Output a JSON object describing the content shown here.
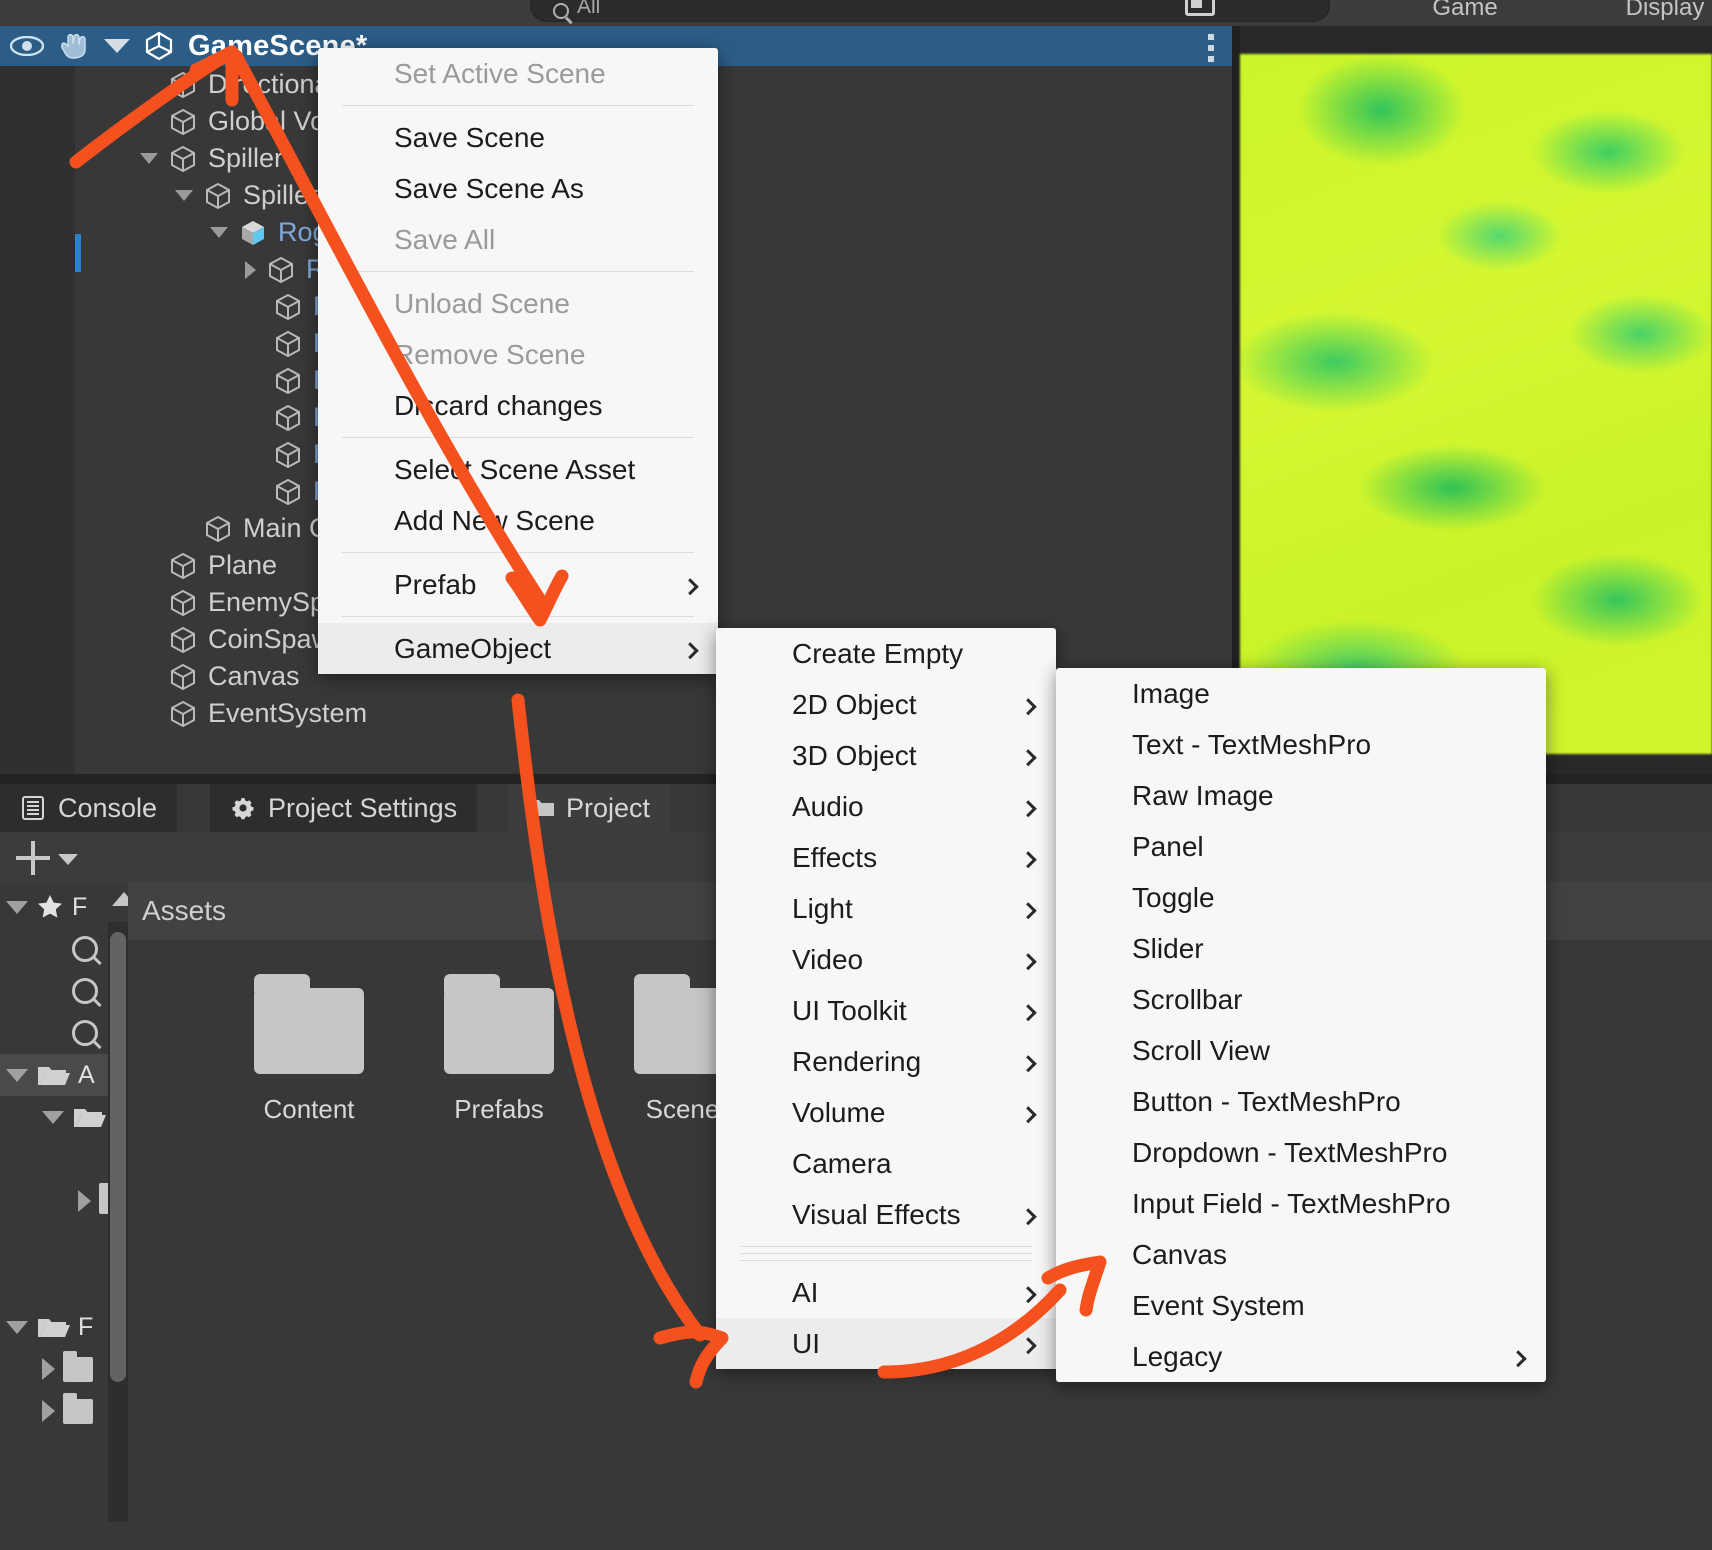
{
  "topbar": {
    "search_placeholder": "All",
    "search_icon": "search-icon",
    "game_tab": "Game",
    "display_tab": "Display"
  },
  "hierarchy": {
    "scene_name": "GameScene*",
    "visibility_icon": "eye-icon",
    "pickability_icon": "hand-icon",
    "unity_icon": "unity-cube-icon",
    "overflow_icon": "kebab-menu-icon",
    "items": [
      {
        "label": "Directiona",
        "indent": 1,
        "fold": "none",
        "icon": "gameobject-cube-icon",
        "blue": false
      },
      {
        "label": "Global Vol",
        "indent": 1,
        "fold": "none",
        "icon": "gameobject-cube-icon",
        "blue": false
      },
      {
        "label": "Spiller",
        "indent": 1,
        "fold": "open",
        "icon": "gameobject-cube-icon",
        "blue": false
      },
      {
        "label": "SpillerM",
        "indent": 2,
        "fold": "open",
        "icon": "gameobject-cube-icon",
        "blue": false
      },
      {
        "label": "Rogue",
        "indent": 3,
        "fold": "open",
        "icon": "prefab-icon",
        "blue": true
      },
      {
        "label": "Rig",
        "indent": 4,
        "fold": "closed",
        "icon": "gameobject-cube-icon",
        "blue": true
      },
      {
        "label": "Rog",
        "indent": 4,
        "fold": "none",
        "icon": "gameobject-cube-icon",
        "blue": true
      },
      {
        "label": "Rog",
        "indent": 4,
        "fold": "none",
        "icon": "gameobject-cube-icon",
        "blue": true
      },
      {
        "label": "Rog",
        "indent": 4,
        "fold": "none",
        "icon": "gameobject-cube-icon",
        "blue": true
      },
      {
        "label": "Rog",
        "indent": 4,
        "fold": "none",
        "icon": "gameobject-cube-icon",
        "blue": true
      },
      {
        "label": "Rog",
        "indent": 4,
        "fold": "none",
        "icon": "gameobject-cube-icon",
        "blue": true
      },
      {
        "label": "Rog",
        "indent": 4,
        "fold": "none",
        "icon": "gameobject-cube-icon",
        "blue": true
      },
      {
        "label": "Main Ca",
        "indent": 2,
        "fold": "none",
        "icon": "gameobject-cube-icon",
        "blue": false
      },
      {
        "label": "Plane",
        "indent": 1,
        "fold": "none",
        "icon": "gameobject-cube-icon",
        "blue": false
      },
      {
        "label": "EnemySpa",
        "indent": 1,
        "fold": "none",
        "icon": "gameobject-cube-icon",
        "blue": false
      },
      {
        "label": "CoinSpawn",
        "indent": 1,
        "fold": "none",
        "icon": "gameobject-cube-icon",
        "blue": false
      },
      {
        "label": "Canvas",
        "indent": 1,
        "fold": "none",
        "icon": "gameobject-cube-icon",
        "blue": false
      },
      {
        "label": "EventSystem",
        "indent": 1,
        "fold": "none",
        "icon": "gameobject-cube-icon",
        "blue": false
      }
    ]
  },
  "scene_menu": {
    "items": [
      {
        "label": "Set Active Scene",
        "state": "disabled",
        "submenu": false,
        "sep_after": true
      },
      {
        "label": "Save Scene",
        "state": "normal",
        "submenu": false,
        "sep_after": false
      },
      {
        "label": "Save Scene As",
        "state": "normal",
        "submenu": false,
        "sep_after": false
      },
      {
        "label": "Save All",
        "state": "disabled",
        "submenu": false,
        "sep_after": true
      },
      {
        "label": "Unload Scene",
        "state": "disabled",
        "submenu": false,
        "sep_after": false
      },
      {
        "label": "Remove Scene",
        "state": "disabled",
        "submenu": false,
        "sep_after": false
      },
      {
        "label": "Discard changes",
        "state": "normal",
        "submenu": false,
        "sep_after": true
      },
      {
        "label": "Select Scene Asset",
        "state": "normal",
        "submenu": false,
        "sep_after": false
      },
      {
        "label": "Add New Scene",
        "state": "normal",
        "submenu": false,
        "sep_after": true
      },
      {
        "label": "Prefab",
        "state": "normal",
        "submenu": true,
        "sep_after": true
      },
      {
        "label": "GameObject",
        "state": "highlight",
        "submenu": true,
        "sep_after": false
      }
    ]
  },
  "gameobject_menu": {
    "items": [
      {
        "label": "Create Empty",
        "state": "normal",
        "submenu": false,
        "sep_after": false
      },
      {
        "label": "2D Object",
        "state": "normal",
        "submenu": true,
        "sep_after": false
      },
      {
        "label": "3D Object",
        "state": "normal",
        "submenu": true,
        "sep_after": false
      },
      {
        "label": "Audio",
        "state": "normal",
        "submenu": true,
        "sep_after": false
      },
      {
        "label": "Effects",
        "state": "normal",
        "submenu": true,
        "sep_after": false
      },
      {
        "label": "Light",
        "state": "normal",
        "submenu": true,
        "sep_after": false
      },
      {
        "label": "Video",
        "state": "normal",
        "submenu": true,
        "sep_after": false
      },
      {
        "label": "UI Toolkit",
        "state": "normal",
        "submenu": true,
        "sep_after": false
      },
      {
        "label": "Rendering",
        "state": "normal",
        "submenu": true,
        "sep_after": false
      },
      {
        "label": "Volume",
        "state": "normal",
        "submenu": true,
        "sep_after": false
      },
      {
        "label": "Camera",
        "state": "normal",
        "submenu": false,
        "sep_after": false
      },
      {
        "label": "Visual Effects",
        "state": "normal",
        "submenu": true,
        "sep_after": true
      },
      {
        "label": "AI",
        "state": "normal",
        "submenu": true,
        "sep_after": false
      },
      {
        "label": "UI",
        "state": "highlight",
        "submenu": true,
        "sep_after": false
      }
    ]
  },
  "ui_menu": {
    "items": [
      {
        "label": "Image",
        "state": "normal",
        "submenu": false
      },
      {
        "label": "Text - TextMeshPro",
        "state": "normal",
        "submenu": false
      },
      {
        "label": "Raw Image",
        "state": "normal",
        "submenu": false
      },
      {
        "label": "Panel",
        "state": "normal",
        "submenu": false
      },
      {
        "label": "Toggle",
        "state": "normal",
        "submenu": false
      },
      {
        "label": "Slider",
        "state": "normal",
        "submenu": false
      },
      {
        "label": "Scrollbar",
        "state": "normal",
        "submenu": false
      },
      {
        "label": "Scroll View",
        "state": "normal",
        "submenu": false
      },
      {
        "label": "Button - TextMeshPro",
        "state": "normal",
        "submenu": false
      },
      {
        "label": "Dropdown - TextMeshPro",
        "state": "normal",
        "submenu": false
      },
      {
        "label": "Input Field - TextMeshPro",
        "state": "normal",
        "submenu": false
      },
      {
        "label": "Canvas",
        "state": "normal",
        "submenu": false
      },
      {
        "label": "Event System",
        "state": "normal",
        "submenu": false
      },
      {
        "label": "Legacy",
        "state": "normal",
        "submenu": true
      }
    ]
  },
  "dock": {
    "tabs": [
      {
        "label": "Console",
        "icon": "console-icon",
        "active": false
      },
      {
        "label": "Project Settings",
        "icon": "gear-icon",
        "active": false
      },
      {
        "label": "Project",
        "icon": "folder-icon",
        "active": true
      }
    ],
    "add_button": "add-icon",
    "add_dropdown": "chevron-down-icon"
  },
  "project": {
    "breadcrumb": "Assets",
    "tree": [
      {
        "label": "F",
        "icon": "star-icon",
        "fold": "open",
        "indent": 0,
        "selected": false
      },
      {
        "label": "",
        "icon": "search-icon",
        "fold": "none",
        "indent": 1,
        "selected": false
      },
      {
        "label": "",
        "icon": "search-icon",
        "fold": "none",
        "indent": 1,
        "selected": false
      },
      {
        "label": "",
        "icon": "search-icon",
        "fold": "none",
        "indent": 1,
        "selected": false
      },
      {
        "label": "A",
        "icon": "folder-open-icon",
        "fold": "open",
        "indent": 0,
        "selected": true
      },
      {
        "label": "",
        "icon": "folder-open-icon",
        "fold": "open",
        "indent": 1,
        "selected": false
      },
      {
        "label": "",
        "icon": "folder-icon",
        "fold": "none",
        "indent": 2,
        "selected": false
      },
      {
        "label": "",
        "icon": "folder-icon",
        "fold": "closed",
        "indent": 2,
        "selected": false
      },
      {
        "label": "",
        "icon": "folder-icon",
        "fold": "none",
        "indent": 2,
        "selected": false
      },
      {
        "label": "",
        "icon": "folder-icon",
        "fold": "none",
        "indent": 2,
        "selected": false
      },
      {
        "label": "F",
        "icon": "folder-open-icon",
        "fold": "open",
        "indent": 0,
        "selected": false
      },
      {
        "label": "",
        "icon": "folder-icon",
        "fold": "closed",
        "indent": 1,
        "selected": false
      },
      {
        "label": "",
        "icon": "folder-icon",
        "fold": "closed",
        "indent": 1,
        "selected": false
      }
    ],
    "assets": [
      {
        "label": "Content",
        "icon": "folder-icon"
      },
      {
        "label": "Prefabs",
        "icon": "folder-icon"
      },
      {
        "label": "Scenes",
        "icon": "folder-icon"
      },
      {
        "label": "",
        "icon": "folder-icon"
      }
    ]
  },
  "annotations": {
    "color": "#f4511e",
    "arrows": [
      "arrow-to-scene-header",
      "arrow-to-gameobject-item",
      "arrow-to-ui-item",
      "arrow-to-canvas-item"
    ]
  }
}
